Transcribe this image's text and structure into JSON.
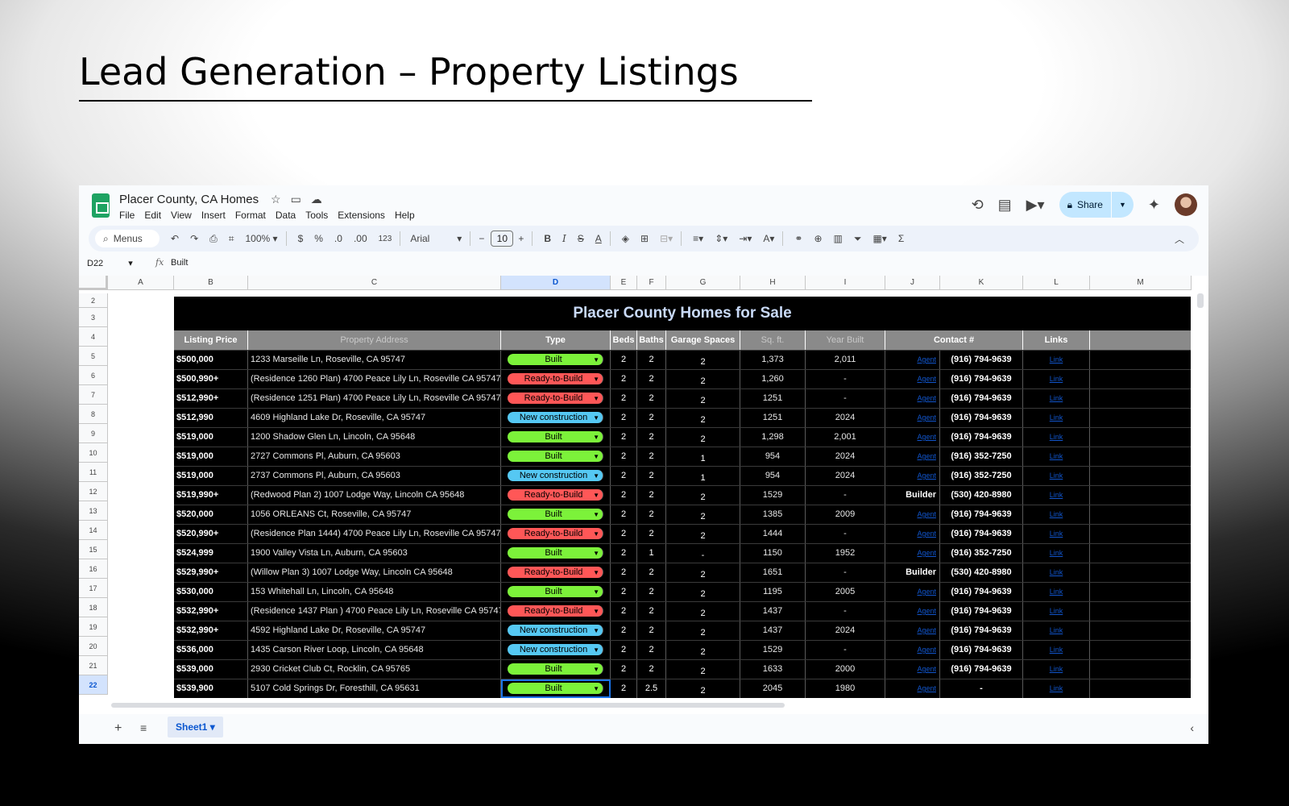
{
  "slide": {
    "title": "Lead Generation – Property Listings"
  },
  "app": {
    "doc_title": "Placer County, CA Homes",
    "menu": [
      "File",
      "Edit",
      "View",
      "Insert",
      "Format",
      "Data",
      "Tools",
      "Extensions",
      "Help"
    ],
    "share_label": "Share"
  },
  "toolbar": {
    "search_label": "Menus",
    "zoom": "100%",
    "currency": "$",
    "percent": "%",
    "dec_decrease": ".0",
    "dec_increase": ".00",
    "number_format": "123",
    "font": "Arial",
    "font_size": "10"
  },
  "formula": {
    "cell_ref": "D22",
    "fx": "fx",
    "value": "Built"
  },
  "columns": [
    "A",
    "B",
    "C",
    "D",
    "E",
    "F",
    "G",
    "H",
    "I",
    "J",
    "K",
    "L",
    "M"
  ],
  "row_numbers": [
    "2",
    "3",
    "4",
    "5",
    "6",
    "7",
    "8",
    "9",
    "10",
    "11",
    "12",
    "13",
    "14",
    "15",
    "16",
    "17",
    "18",
    "19",
    "20",
    "21",
    "22"
  ],
  "table": {
    "banner": "Placer County Homes for Sale",
    "headers": [
      "Listing Price",
      "Property Address",
      "Type",
      "Beds",
      "Baths",
      "Garage Spaces",
      "Sq. ft.",
      "Year Built",
      "Contact #",
      "Links"
    ],
    "rows": [
      {
        "price": "$500,000",
        "address": "1233 Marseille Ln, Roseville, CA 95747",
        "type": "Built",
        "beds": "2",
        "baths": "2",
        "garage": "2",
        "sqft": "1,373",
        "year": "2,011",
        "agent": "Agent",
        "contact": "(916) 794-9639",
        "link": "Link"
      },
      {
        "price": "$500,990+",
        "address": "(Residence 1260 Plan) 4700 Peace Lily Ln, Roseville CA 95747",
        "type": "Ready-to-Build",
        "beds": "2",
        "baths": "2",
        "garage": "2",
        "sqft": "1,260",
        "year": "-",
        "agent": "Agent",
        "contact": "(916) 794-9639",
        "link": "Link"
      },
      {
        "price": "$512,990+",
        "address": "(Residence 1251 Plan) 4700 Peace Lily Ln, Roseville CA 95747",
        "type": "Ready-to-Build",
        "beds": "2",
        "baths": "2",
        "garage": "2",
        "sqft": "1251",
        "year": "-",
        "agent": "Agent",
        "contact": "(916) 794-9639",
        "link": "Link"
      },
      {
        "price": "$512,990",
        "address": "4609 Highland Lake Dr, Roseville, CA 95747",
        "type": "New construction",
        "beds": "2",
        "baths": "2",
        "garage": "2",
        "sqft": "1251",
        "year": "2024",
        "agent": "Agent",
        "contact": "(916) 794-9639",
        "link": "Link"
      },
      {
        "price": "$519,000",
        "address": "1200 Shadow Glen Ln, Lincoln, CA 95648",
        "type": "Built",
        "beds": "2",
        "baths": "2",
        "garage": "2",
        "sqft": "1,298",
        "year": "2,001",
        "agent": "Agent",
        "contact": "(916) 794-9639",
        "link": "Link"
      },
      {
        "price": "$519,000",
        "address": "2727 Commons Pl, Auburn, CA 95603",
        "type": "Built",
        "beds": "2",
        "baths": "2",
        "garage": "1",
        "sqft": "954",
        "year": "2024",
        "agent": "Agent",
        "contact": "(916) 352-7250",
        "link": "Link"
      },
      {
        "price": "$519,000",
        "address": "2737 Commons Pl, Auburn, CA 95603",
        "type": "New construction",
        "beds": "2",
        "baths": "2",
        "garage": "1",
        "sqft": "954",
        "year": "2024",
        "agent": "Agent",
        "contact": "(916) 352-7250",
        "link": "Link"
      },
      {
        "price": "$519,990+",
        "address": "(Redwood Plan 2) 1007 Lodge Way, Lincoln CA 95648",
        "type": "Ready-to-Build",
        "beds": "2",
        "baths": "2",
        "garage": "2",
        "sqft": "1529",
        "year": "-",
        "agent": "Builder",
        "contact": "(530) 420-8980",
        "link": "Link"
      },
      {
        "price": "$520,000",
        "address": "1056 ORLEANS Ct, Roseville, CA 95747",
        "type": "Built",
        "beds": "2",
        "baths": "2",
        "garage": "2",
        "sqft": "1385",
        "year": "2009",
        "agent": "Agent",
        "contact": "(916) 794-9639",
        "link": "Link"
      },
      {
        "price": "$520,990+",
        "address": "(Residence Plan 1444) 4700 Peace Lily Ln, Roseville CA 95747",
        "type": "Ready-to-Build",
        "beds": "2",
        "baths": "2",
        "garage": "2",
        "sqft": "1444",
        "year": "-",
        "agent": "Agent",
        "contact": "(916) 794-9639",
        "link": "Link"
      },
      {
        "price": "$524,999",
        "address": "1900 Valley Vista Ln, Auburn, CA 95603",
        "type": "Built",
        "beds": "2",
        "baths": "1",
        "garage": "-",
        "sqft": "1150",
        "year": "1952",
        "agent": "Agent",
        "contact": "(916) 352-7250",
        "link": "Link"
      },
      {
        "price": "$529,990+",
        "address": "(Willow Plan 3) 1007 Lodge Way, Lincoln CA 95648",
        "type": "Ready-to-Build",
        "beds": "2",
        "baths": "2",
        "garage": "2",
        "sqft": "1651",
        "year": "-",
        "agent": "Builder",
        "contact": "(530) 420-8980",
        "link": "Link"
      },
      {
        "price": "$530,000",
        "address": "153 Whitehall Ln, Lincoln, CA 95648",
        "type": "Built",
        "beds": "2",
        "baths": "2",
        "garage": "2",
        "sqft": "1195",
        "year": "2005",
        "agent": "Agent",
        "contact": "(916) 794-9639",
        "link": "Link"
      },
      {
        "price": "$532,990+",
        "address": "(Residence 1437 Plan ) 4700 Peace Lily Ln, Roseville CA 95747",
        "type": "Ready-to-Build",
        "beds": "2",
        "baths": "2",
        "garage": "2",
        "sqft": "1437",
        "year": "-",
        "agent": "Agent",
        "contact": "(916) 794-9639",
        "link": "Link"
      },
      {
        "price": "$532,990+",
        "address": "4592 Highland Lake Dr, Roseville, CA 95747",
        "type": "New construction",
        "beds": "2",
        "baths": "2",
        "garage": "2",
        "sqft": "1437",
        "year": "2024",
        "agent": "Agent",
        "contact": "(916) 794-9639",
        "link": "Link"
      },
      {
        "price": "$536,000",
        "address": "1435 Carson River Loop, Lincoln, CA 95648",
        "type": "New construction",
        "beds": "2",
        "baths": "2",
        "garage": "2",
        "sqft": "1529",
        "year": "-",
        "agent": "Agent",
        "contact": "(916) 794-9639",
        "link": "Link"
      },
      {
        "price": "$539,000",
        "address": "2930 Cricket Club Ct, Rocklin, CA 95765",
        "type": "Built",
        "beds": "2",
        "baths": "2",
        "garage": "2",
        "sqft": "1633",
        "year": "2000",
        "agent": "Agent",
        "contact": "(916) 794-9639",
        "link": "Link"
      },
      {
        "price": "$539,900",
        "address": "5107 Cold Springs Dr, Foresthill, CA 95631",
        "type": "Built",
        "beds": "2",
        "baths": "2.5",
        "garage": "2",
        "sqft": "2045",
        "year": "1980",
        "agent": "Agent",
        "contact": "-",
        "link": "Link"
      }
    ]
  },
  "tabs": {
    "sheet_name": "Sheet1"
  },
  "colors": {
    "built": "#7cf23a",
    "ready_to_build": "#ff5757",
    "new_construction": "#55c8f3",
    "banner_text": "#c9daf8"
  }
}
